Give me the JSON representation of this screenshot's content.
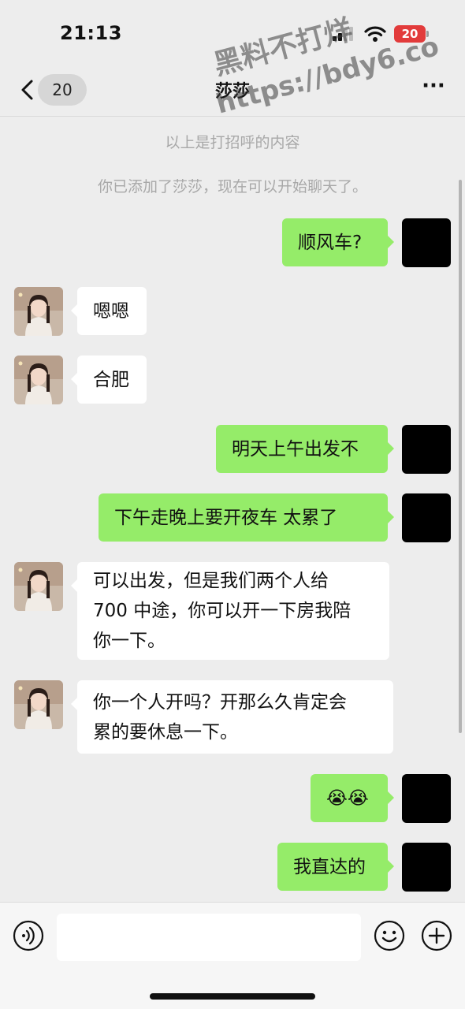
{
  "status_bar": {
    "time": "21:13",
    "battery_level": "20",
    "battery_color": "#e23b3b",
    "icons": [
      "signal-icon",
      "wifi-icon",
      "battery-icon"
    ]
  },
  "nav": {
    "back_badge": "20",
    "title": "莎莎",
    "more_label": "···"
  },
  "system_messages": {
    "greeting_hint": "以上是打招呼的内容",
    "added_notice": "你已添加了莎莎，现在可以开始聊天了。"
  },
  "watermark": {
    "line1": "黑料不打烊",
    "line2": "https://bdy6.co"
  },
  "messages": [
    {
      "side": "out",
      "text": "顺风车?"
    },
    {
      "side": "in",
      "text": "嗯嗯"
    },
    {
      "side": "in",
      "text": "合肥"
    },
    {
      "side": "out",
      "text": "明天上午出发不"
    },
    {
      "side": "out",
      "text": "下午走晚上要开夜车  太累了"
    },
    {
      "side": "in",
      "text": "可以出发，但是我们两个人给\n700 中途，你可以开一下房我陪\n你一下。"
    },
    {
      "side": "in",
      "text": "你一个人开吗？开那么久肯定会\n累的要休息一下。"
    },
    {
      "side": "out",
      "text": "😭😭"
    },
    {
      "side": "out",
      "text": "我直达的"
    }
  ],
  "input_bar": {
    "placeholder": "",
    "icons": [
      "voice-icon",
      "emoji-icon",
      "plus-icon"
    ]
  },
  "colors": {
    "background": "#ededed",
    "outgoing_bubble": "#95ec69",
    "incoming_bubble": "#ffffff"
  }
}
